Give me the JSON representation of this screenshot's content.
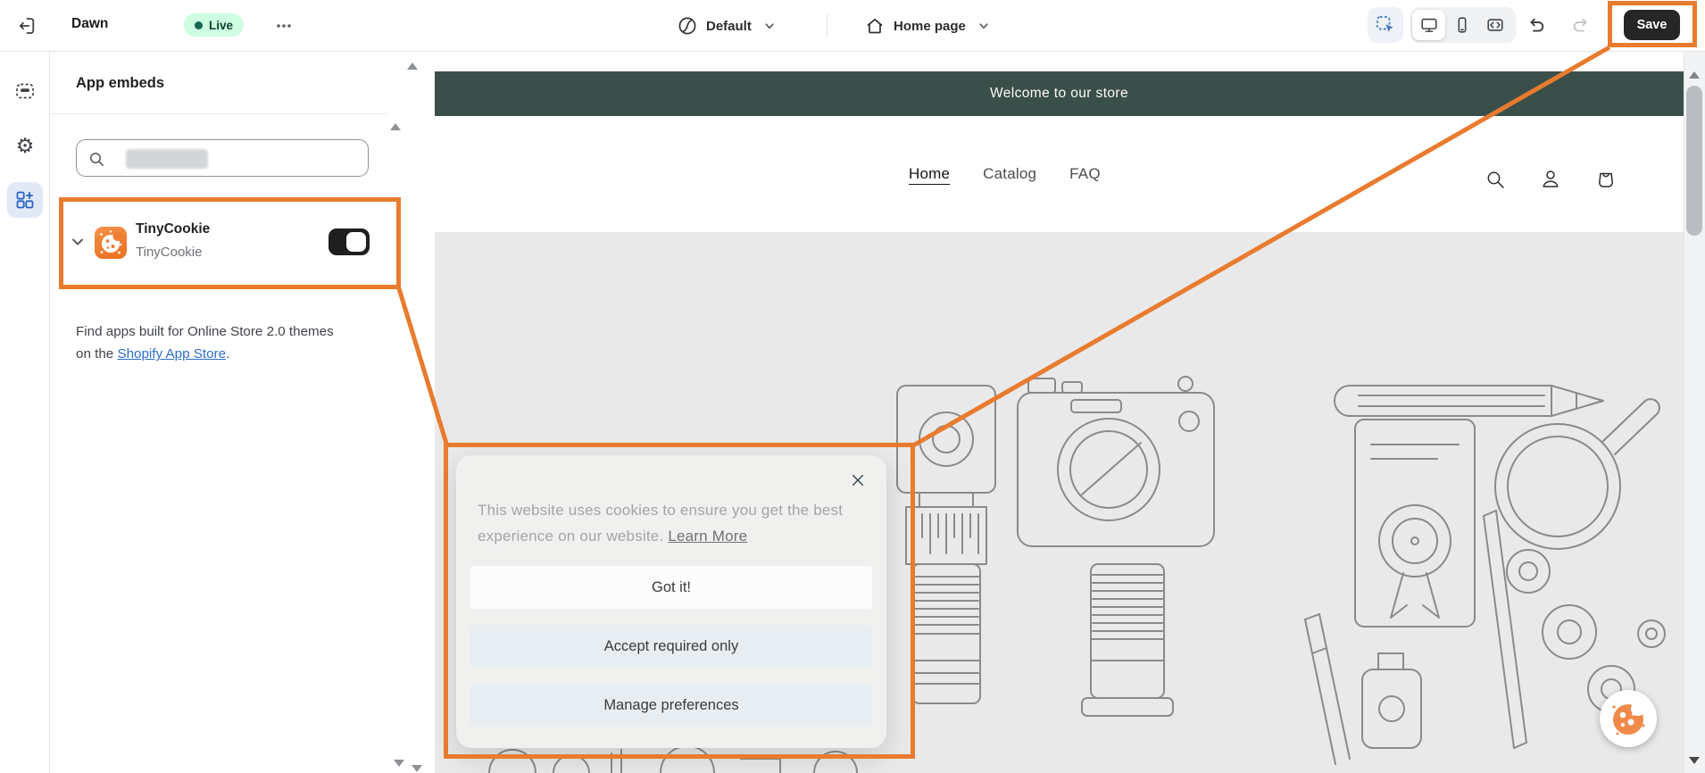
{
  "topbar": {
    "theme_name": "Dawn",
    "live_badge": "Live",
    "locale_selector": "Default",
    "page_selector": "Home page",
    "save_label": "Save"
  },
  "panel": {
    "title": "App embeds",
    "search_placeholder": "",
    "embed": {
      "name": "TinyCookie",
      "developer": "TinyCookie",
      "enabled": true
    },
    "footer": {
      "text": "Find apps built for Online Store 2.0 themes on the ",
      "link_label": "Shopify App Store",
      "suffix": "."
    }
  },
  "preview": {
    "announcement_text": "Welcome to our store",
    "nav": [
      {
        "label": "Home",
        "active": true
      },
      {
        "label": "Catalog",
        "active": false
      },
      {
        "label": "FAQ",
        "active": false
      }
    ],
    "cookie_banner": {
      "message": "This website uses cookies to ensure you get the best experience on our website. ",
      "learn_more_label": "Learn More",
      "buttons": [
        {
          "label": "Got it!"
        },
        {
          "label": "Accept required only"
        },
        {
          "label": "Manage preferences"
        }
      ]
    }
  },
  "icons": {
    "settings_glyph": "⚙"
  },
  "colors": {
    "annotation_orange": "#e87b2e",
    "announcement_bg": "#3b4f4a",
    "live_badge_bg": "#cdfee1",
    "live_badge_text": "#0e3d2e",
    "app_icon_orange": "#f07d33",
    "cookie_fab_orange": "#ef8a4a",
    "link_blue": "#2c6ecb",
    "rail_active_blue": "#2a62c5",
    "toggle_on": "#1f1f1f"
  }
}
